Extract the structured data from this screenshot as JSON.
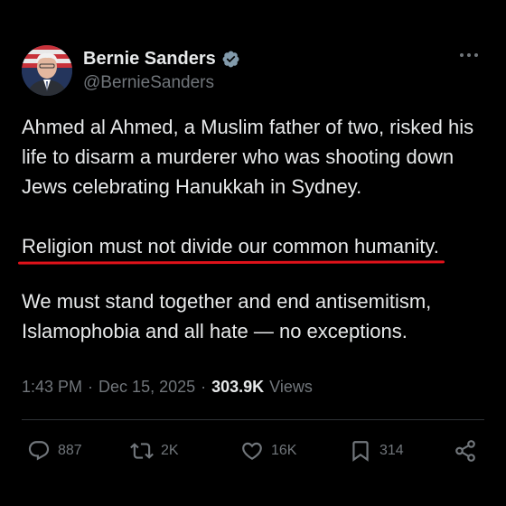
{
  "author": {
    "display_name": "Bernie Sanders",
    "handle": "@BernieSanders",
    "verified_icon": "verified-badge-icon",
    "avatar_icon": "avatar-photo"
  },
  "tweet": {
    "paragraph1": "Ahmed al Ahmed, a Muslim father of two, risked his life to disarm a murderer who was shooting down Jews celebrating Hanukkah in Sydney.",
    "paragraph2": "Religion must not divide our common humanity.",
    "paragraph3": "We must stand together and end antisemitism, Islamophobia and all hate — no exceptions."
  },
  "meta": {
    "time": "1:43 PM",
    "separator": "·",
    "date": "Dec 15, 2025",
    "views_count": "303.9K",
    "views_label": "Views"
  },
  "actions": {
    "replies": "887",
    "reposts": "2K",
    "likes": "16K",
    "bookmarks": "314"
  },
  "colors": {
    "background": "#000000",
    "text": "#e7e9ea",
    "muted": "#71767b",
    "verified": "#829aab",
    "highlight_underline": "#e0121a"
  }
}
